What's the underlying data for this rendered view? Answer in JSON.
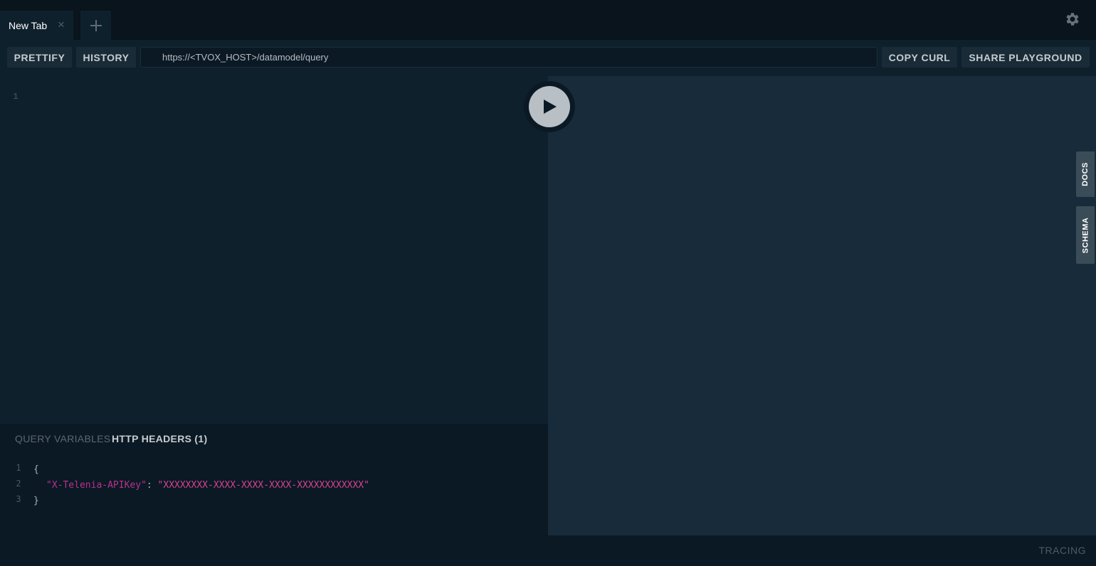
{
  "tabs": [
    {
      "label": "New Tab",
      "close_icon": "×"
    }
  ],
  "tabbar": {
    "new_tab_icon": "plus-icon",
    "settings_icon": "gear-icon"
  },
  "toolbar": {
    "prettify_label": "PRETTIFY",
    "history_label": "HISTORY",
    "endpoint_url": "https://<TVOX_HOST>/datamodel/query",
    "copy_curl_label": "COPY CURL",
    "share_label": "SHARE PLAYGROUND"
  },
  "editor": {
    "line_numbers": [
      "1"
    ],
    "run_icon": "play-icon"
  },
  "side_tabs": {
    "docs_label": "DOCS",
    "schema_label": "SCHEMA"
  },
  "variables_panel": {
    "query_variables_label": "QUERY VARIABLES",
    "http_headers_label": "HTTP HEADERS (1)",
    "lines": [
      {
        "num": "1",
        "text": "{"
      },
      {
        "num": "2",
        "key": "\"X-Telenia-APIKey\"",
        "sep": ": ",
        "value": "\"XXXXXXXX-XXXX-XXXX-XXXX-XXXXXXXXXXXX\""
      },
      {
        "num": "3",
        "text": "}"
      }
    ]
  },
  "footer": {
    "tracing_label": "TRACING"
  },
  "colors": {
    "background": "#0b1924",
    "panel": "#0f202d",
    "result_pane": "#172b3a",
    "string_key": "#b8318e",
    "string_value": "#d64292"
  }
}
